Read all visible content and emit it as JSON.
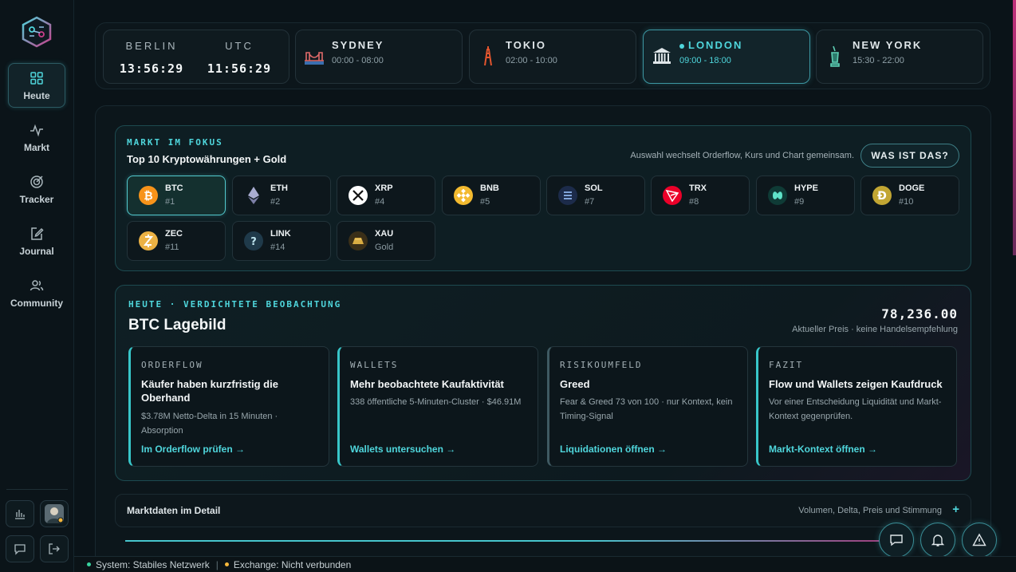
{
  "sidebar": {
    "items": [
      {
        "label": "Heute",
        "icon": "grid-icon"
      },
      {
        "label": "Markt",
        "icon": "pulse-icon"
      },
      {
        "label": "Tracker",
        "icon": "target-icon"
      },
      {
        "label": "Journal",
        "icon": "journal-edit-icon"
      },
      {
        "label": "Community",
        "icon": "users-icon"
      }
    ]
  },
  "clocks": [
    {
      "label": "BERLIN",
      "time": "13:56:29"
    },
    {
      "label": "UTC",
      "time": "11:56:29"
    }
  ],
  "markets": [
    {
      "name": "SYDNEY",
      "hours": "00:00 - 08:00",
      "icon": "bridge-icon"
    },
    {
      "name": "TOKIO",
      "hours": "02:00 - 10:00",
      "icon": "tower-icon"
    },
    {
      "name": "LONDON",
      "hours": "09:00 - 18:00",
      "icon": "bank-icon",
      "active": true
    },
    {
      "name": "NEW YORK",
      "hours": "15:30 - 22:00",
      "icon": "statue-icon"
    }
  ],
  "focus": {
    "eyebrow": "MARKT IM FOKUS",
    "title": "Top 10 Kryptowährungen + Gold",
    "hint": "Auswahl wechselt Orderflow, Kurs und Chart gemeinsam.",
    "button": "WAS IST DAS?",
    "coins": [
      {
        "symbol": "BTC",
        "rank": "#1",
        "color": "#f7931a"
      },
      {
        "symbol": "ETH",
        "rank": "#2",
        "color": "#8c8fb8"
      },
      {
        "symbol": "XRP",
        "rank": "#4",
        "color": "#ffffff"
      },
      {
        "symbol": "BNB",
        "rank": "#5",
        "color": "#f3ba2f"
      },
      {
        "symbol": "SOL",
        "rank": "#7",
        "color": "#1c2b4a"
      },
      {
        "symbol": "TRX",
        "rank": "#8",
        "color": "#eb0029"
      },
      {
        "symbol": "HYPE",
        "rank": "#9",
        "color": "#0f3b36"
      },
      {
        "symbol": "DOGE",
        "rank": "#10",
        "color": "#c2a633"
      },
      {
        "symbol": "ZEC",
        "rank": "#11",
        "color": "#ecb244"
      },
      {
        "symbol": "LINK",
        "rank": "#14",
        "color": "#1f3a4a"
      },
      {
        "symbol": "XAU",
        "rank": "Gold",
        "color": "#c9a03a"
      }
    ]
  },
  "lage": {
    "eyebrow": "HEUTE · VERDICHTETE BEOBACHTUNG",
    "title": "BTC Lagebild",
    "price": "78,236.00",
    "price_note": "Aktueller Preis · keine Handelsempfehlung",
    "cards": [
      {
        "kicker": "ORDERFLOW",
        "title": "Käufer haben kurzfristig die Oberhand",
        "desc": "$3.78M Netto-Delta in 15 Minuten · Absorption",
        "link": "Im Orderflow prüfen →"
      },
      {
        "kicker": "WALLETS",
        "title": "Mehr beobachtete Kaufaktivität",
        "desc": "338 öffentliche 5-Minuten-Cluster · $46.91M",
        "link": "Wallets untersuchen →"
      },
      {
        "kicker": "RISIKOUMFELD",
        "title": "Greed",
        "desc": "Fear & Greed 73 von 100 · nur Kontext, kein Timing-Signal",
        "link": "Liquidationen öffnen →"
      },
      {
        "kicker": "FAZIT",
        "title": "Flow und Wallets zeigen Kaufdruck",
        "desc": "Vor einer Entscheidung Liquidität und Markt-Kontext gegenprüfen.",
        "link": "Markt-Kontext öffnen →"
      }
    ]
  },
  "details": {
    "label": "Marktdaten im Detail",
    "note": "Volumen, Delta, Preis und Stimmung",
    "plus": "+"
  },
  "status": {
    "system": "System: Stabiles Netzwerk",
    "separator": "|",
    "exchange": "Exchange: Nicht verbunden",
    "system_color": "#38d39f",
    "exchange_color": "#f5b73b"
  },
  "accent": "#4fd6dc"
}
